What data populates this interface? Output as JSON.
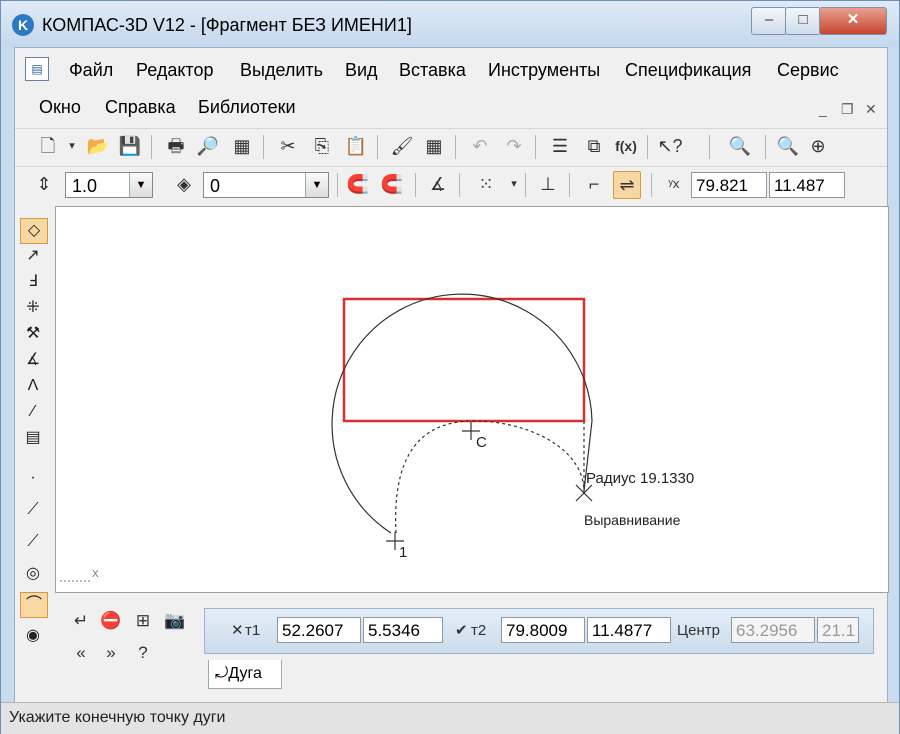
{
  "window": {
    "title": "КОМПАС-3D V12 - [Фрагмент БЕЗ ИМЕНИ1]",
    "app_icon": "kompas-logo-icon",
    "controls": {
      "minimize": "–",
      "maximize": "□",
      "close": "✕"
    }
  },
  "menu": {
    "items": [
      "Файл",
      "Редактор",
      "Выделить",
      "Вид",
      "Вставка",
      "Инструменты",
      "Спецификация",
      "Сервис",
      "Окно",
      "Справка",
      "Библиотеки"
    ],
    "mdi_controls": {
      "minimize": "_",
      "restore": "❐",
      "close": "✕"
    }
  },
  "toolbar_standard": {
    "icons": [
      "new-document-icon",
      "open-folder-icon",
      "save-icon",
      "print-icon",
      "print-preview-icon",
      "manager-icon",
      "cut-icon",
      "copy-icon",
      "paste-icon",
      "format-brush-icon",
      "calculator-icon",
      "undo-icon",
      "redo-icon",
      "parameters-icon",
      "variables-icon",
      "function-icon",
      "help-pointer-icon",
      "zoom-window-icon",
      "zoom-out-icon",
      "zoom-fit-icon"
    ]
  },
  "toolbar_current_state": {
    "step_value": "1.0",
    "layer_value": "0",
    "coord_x": "79.821",
    "coord_y": "11.487"
  },
  "canvas": {
    "point_labels": {
      "center": "C",
      "start": "1"
    },
    "radius_label": "Радиус 19.1330",
    "align_label": "Выравнивание",
    "axis_label": "X",
    "colors": {
      "highlight_rect": "#d9302c",
      "geometry": "#333333"
    }
  },
  "property_bar": {
    "t1_label": "т1",
    "t1_x": "52.2607",
    "t1_y": "5.5346",
    "t2_label": "т2",
    "t2_x": "79.8009",
    "t2_y": "11.4877",
    "center_label": "Центр",
    "center_x": "63.2956",
    "center_y": "21.1"
  },
  "tab": {
    "label": "Дуга"
  },
  "status": {
    "message": "Укажите конечную точку дуги"
  }
}
